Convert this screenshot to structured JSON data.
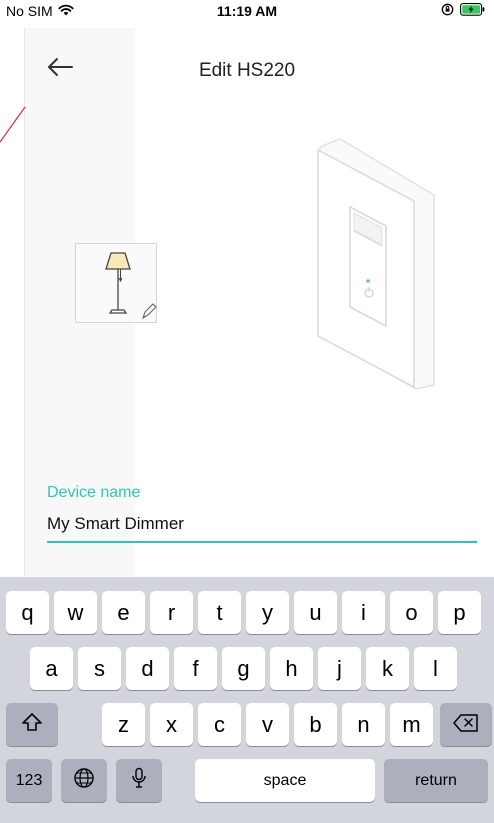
{
  "status_bar": {
    "carrier": "No SIM",
    "time": "11:19 AM",
    "icons": [
      "wifi-icon",
      "orientation-lock-icon",
      "battery-charging-icon"
    ]
  },
  "header": {
    "title": "Edit HS220",
    "back_icon": "arrow-left-icon"
  },
  "device_icon": {
    "icon": "floor-lamp-icon",
    "edit_icon": "pencil-icon"
  },
  "device_name": {
    "label": "Device name",
    "value": "My Smart Dimmer"
  },
  "keyboard": {
    "row1": [
      "q",
      "w",
      "e",
      "r",
      "t",
      "y",
      "u",
      "i",
      "o",
      "p"
    ],
    "row2": [
      "a",
      "s",
      "d",
      "f",
      "g",
      "h",
      "j",
      "k",
      "l"
    ],
    "row3": [
      "z",
      "x",
      "c",
      "v",
      "b",
      "n",
      "m"
    ],
    "shift_icon": "shift-icon",
    "delete_icon": "delete-backspace-icon",
    "numbers_label": "123",
    "globe_icon": "globe-icon",
    "mic_icon": "microphone-icon",
    "space_label": "space",
    "return_label": "return"
  },
  "colors": {
    "accent": "#2cc7bb",
    "keyboard_bg": "#d2d5db",
    "key_bg": "#ffffff",
    "special_key_bg": "#abb0bc"
  }
}
